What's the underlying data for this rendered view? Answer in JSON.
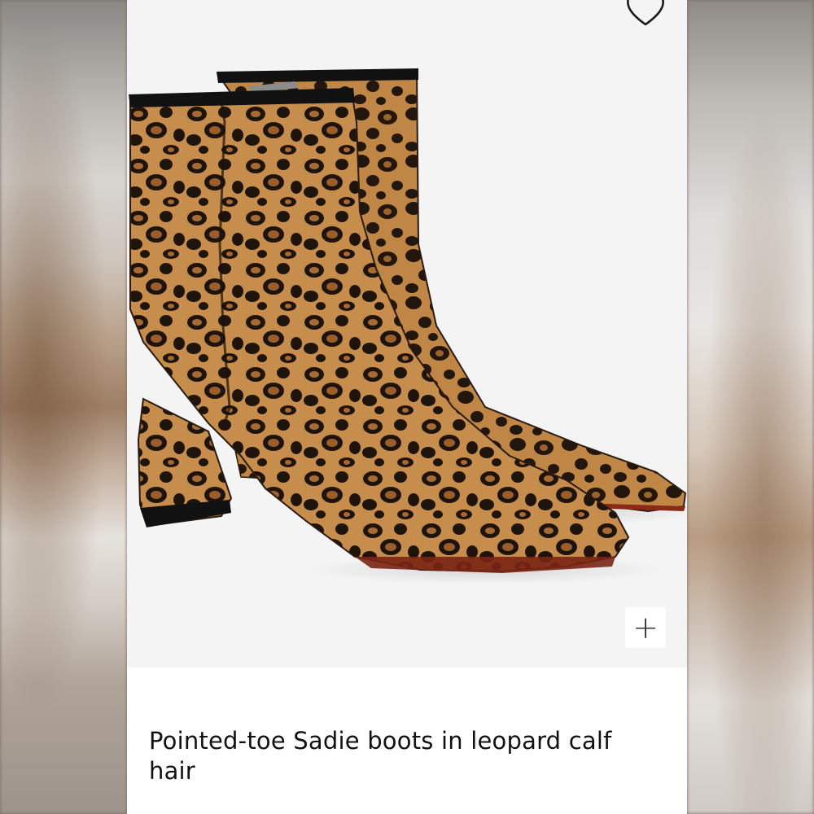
{
  "product": {
    "title": "Pointed-toe Sadie boots in leopard calf hair",
    "image_alt": "Leopard print pointed-toe ankle boots"
  },
  "actions": {
    "favorite_icon": "heart-outline-icon",
    "zoom_icon": "plus-icon",
    "zoom_label": "+"
  },
  "colors": {
    "background": "#ffffff",
    "image_background": "#f4f4f4",
    "leopard_base": "#c9924f",
    "leopard_spot": "#1f140c"
  }
}
